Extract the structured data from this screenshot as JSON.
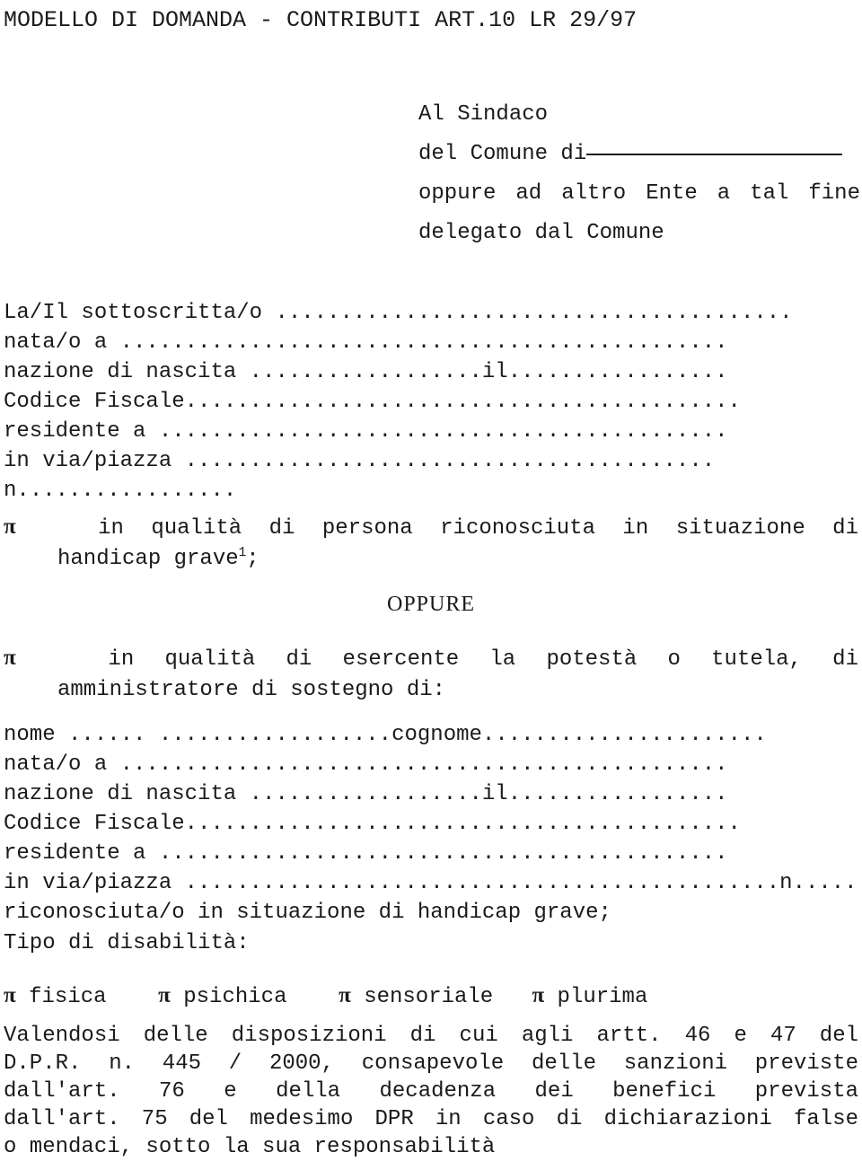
{
  "document": {
    "title": "MODELLO DI DOMANDA - CONTRIBUTI ART.10 LR 29/97",
    "language": "it"
  },
  "addressee": {
    "line1": "Al Sindaco",
    "line2_label": "del Comune di",
    "line2_blank": "________________",
    "line3": "oppure ad altro Ente a tal fine",
    "line4": "delegato dal Comune"
  },
  "applicant_fields": [
    {
      "label": "La/Il sottoscritta/o ",
      "dots1": "........................................"
    },
    {
      "label": "nata/o a ",
      "dots1": "..............................................."
    },
    {
      "label": "nazione di nascita ",
      "dots1": "..................",
      "mid": "il",
      "dots2": "................."
    },
    {
      "label": "Codice Fiscale",
      "dots1": "..........................................."
    },
    {
      "label": "residente a ",
      "dots1": "............................................"
    },
    {
      "label": "in via/piazza ",
      "dots1": "........................................."
    },
    {
      "label": "n.",
      "dots1": "................"
    }
  ],
  "option_one": {
    "marker": "π",
    "text_line1": "in qualità di persona riconosciuta in situazione di",
    "text_line2": "handicap grave",
    "footnote_ref": "1",
    "text_line2_tail": ";"
  },
  "separator": {
    "text": "OPPURE"
  },
  "option_two": {
    "marker": "π",
    "text_line1": "in qualità di esercente la potestà o tutela, di",
    "text_line2": "amministratore di sostegno di:"
  },
  "beneficiary_fields": [
    {
      "label": "nome",
      "dots1": "......",
      "gap": " ",
      "dots2": "..................",
      "mid": "cognome",
      "dots3": "......................"
    },
    {
      "label": "nata/o a ",
      "dots1": "..............................................."
    },
    {
      "label": "nazione di nascita ",
      "dots1": "..................",
      "mid": "il",
      "dots2": "................."
    },
    {
      "label": "Codice Fiscale",
      "dots1": "..........................................."
    },
    {
      "label": "residente a ",
      "dots1": "............................................"
    },
    {
      "label": "in via/piazza ",
      "dots1": "..............................................",
      "mid": "n",
      "dots2": "......"
    }
  ],
  "beneficiary_status": "riconosciuta/o in situazione di handicap grave;",
  "disability": {
    "label": "Tipo di disabilità:",
    "options": [
      {
        "marker": "π",
        "label": "fisica"
      },
      {
        "marker": "π",
        "label": "psichica"
      },
      {
        "marker": "π",
        "label": "sensoriale"
      },
      {
        "marker": "π",
        "label": "plurima"
      }
    ]
  },
  "declaration": {
    "line1": "Valendosi delle disposizioni di cui agli artt. 46 e 47 del",
    "line2": "D.P.R. n. 445 / 2000, consapevole delle sanzioni previste",
    "line3": "dall'art. 76 e della decadenza dei benefici prevista",
    "line4": "dall'art. 75 del medesimo DPR in caso di dichiarazioni false",
    "line5": "o mendaci, sotto la sua responsabilità"
  },
  "colors": {
    "text": "#1a1a1a",
    "background": "#ffffff"
  }
}
